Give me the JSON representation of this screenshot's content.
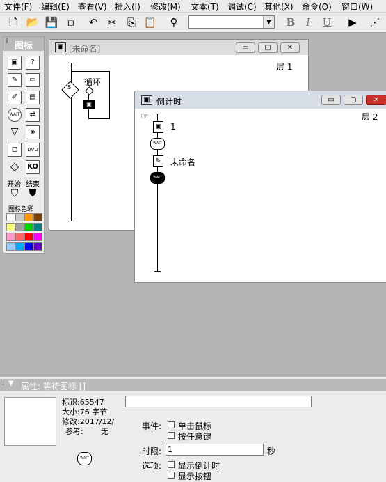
{
  "menubar": {
    "items": [
      "文件(F)",
      "编辑(E)",
      "查看(V)",
      "插入(I)",
      "修改(M)",
      "文本(T)",
      "调试(C)",
      "其他(X)",
      "命令(O)",
      "窗口(W)"
    ]
  },
  "toolbar": {
    "buttons": [
      "new-file",
      "open-folder",
      "save-all",
      "import",
      "undo",
      "cut",
      "copy",
      "paste",
      "find"
    ],
    "font_value": "",
    "bold": "B",
    "italic": "I",
    "underline": "U"
  },
  "palette": {
    "title": "图标",
    "start_label": "开始",
    "end_label": "结束",
    "color_label": "图标色彩",
    "colors": [
      "#ffffff",
      "#c8c8c8",
      "#ff9900",
      "#804000",
      "#ffff80",
      "#a0a0a0",
      "#00cc00",
      "#008080",
      "#ff99cc",
      "#ff6666",
      "#ff0000",
      "#ff00ff",
      "#99ccff",
      "#00aaff",
      "#0000ff",
      "#6600cc"
    ]
  },
  "window_main": {
    "title": "[未命名]",
    "level": "层 1",
    "loop_label": "循环",
    "decision_label": "S"
  },
  "window_countdown": {
    "title": "倒计时",
    "level": "层 2",
    "icons": [
      {
        "type": "display",
        "label": "1"
      },
      {
        "type": "wait",
        "label": ""
      },
      {
        "type": "calc",
        "label": "未命名"
      },
      {
        "type": "wait",
        "label": ""
      }
    ],
    "wait_glyph": "WAIT"
  },
  "properties": {
    "header": "属性: 等待图标 []",
    "id_label": "标识:65547",
    "size_label": "大小:76 字节",
    "modified_label": "修改:2017/12/",
    "ref_label": "参考:",
    "ref_value": "无",
    "name_value": "",
    "event_label": "事件:",
    "event_mouse": "单击鼠标",
    "event_key": "按任意键",
    "time_label": "时限:",
    "time_value": "1",
    "time_unit": "秒",
    "options_label": "选项:",
    "opt_countdown": "显示倒计时",
    "opt_button": "显示按钮"
  }
}
